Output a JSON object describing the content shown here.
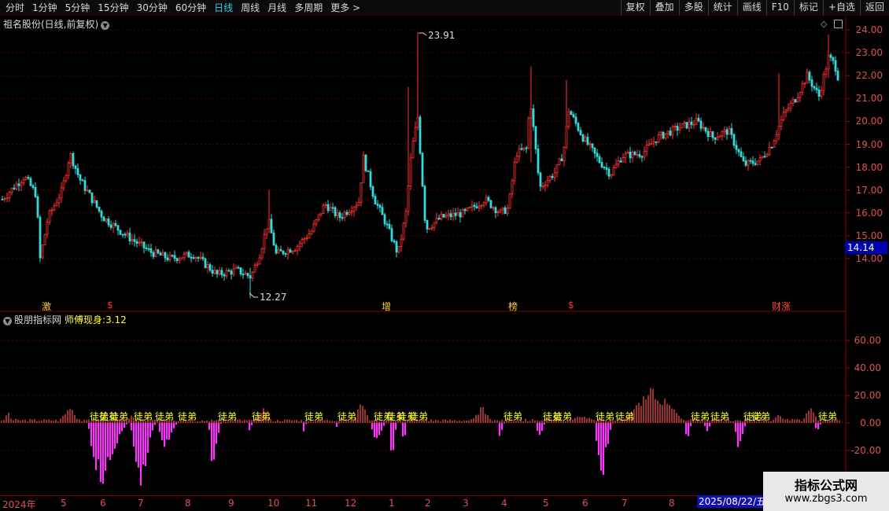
{
  "toolbar": {
    "periods": [
      "分时",
      "1分钟",
      "5分钟",
      "15分钟",
      "30分钟",
      "60分钟",
      "日线",
      "周线",
      "月线",
      "多周期",
      "更多 >"
    ],
    "active_period": "日线",
    "tools": [
      "复权",
      "叠加",
      "多股",
      "统计",
      "画线",
      "F10",
      "标记",
      "+自选",
      "返回"
    ]
  },
  "stock": {
    "title": "祖名股份(日线,前复权)",
    "current_price": "14.14",
    "high_label": "23.91",
    "low_label": "12.27"
  },
  "price_axis": [
    "24.00",
    "23.00",
    "22.00",
    "21.00",
    "20.00",
    "19.00",
    "18.00",
    "17.00",
    "16.00",
    "15.00",
    "14.00"
  ],
  "indicator": {
    "name": "股朋指标网",
    "line_name": "师傅现身:",
    "line_value": "3.12",
    "axis": [
      "60.00",
      "40.00",
      "20.00",
      "0.00",
      "-20.00"
    ],
    "signal_label": "徒弟"
  },
  "markers": [
    {
      "text": "激",
      "color": "#ffcc33"
    },
    {
      "text": "$",
      "color": "#ff3333"
    },
    {
      "text": "增",
      "color": "#ffcc33"
    },
    {
      "text": "榜",
      "color": "#ffcc33"
    },
    {
      "text": "$",
      "color": "#ff3333"
    },
    {
      "text": "财涨",
      "color": "#ff4444"
    }
  ],
  "date_axis": [
    "2024年",
    "5",
    "6",
    "7",
    "8",
    "9",
    "10",
    "11",
    "12",
    "1",
    "2",
    "3",
    "4",
    "5",
    "6",
    "7",
    "8"
  ],
  "selected_date": "2025/08/22/五",
  "watermark": {
    "title": "指标公式网",
    "url": "www.zbgs3.com"
  },
  "colors": {
    "up": "#ff3333",
    "down": "#33dddd",
    "hist_pos": "#ff5555",
    "hist_neg": "#ff33ff",
    "label": "#ffff33"
  }
}
